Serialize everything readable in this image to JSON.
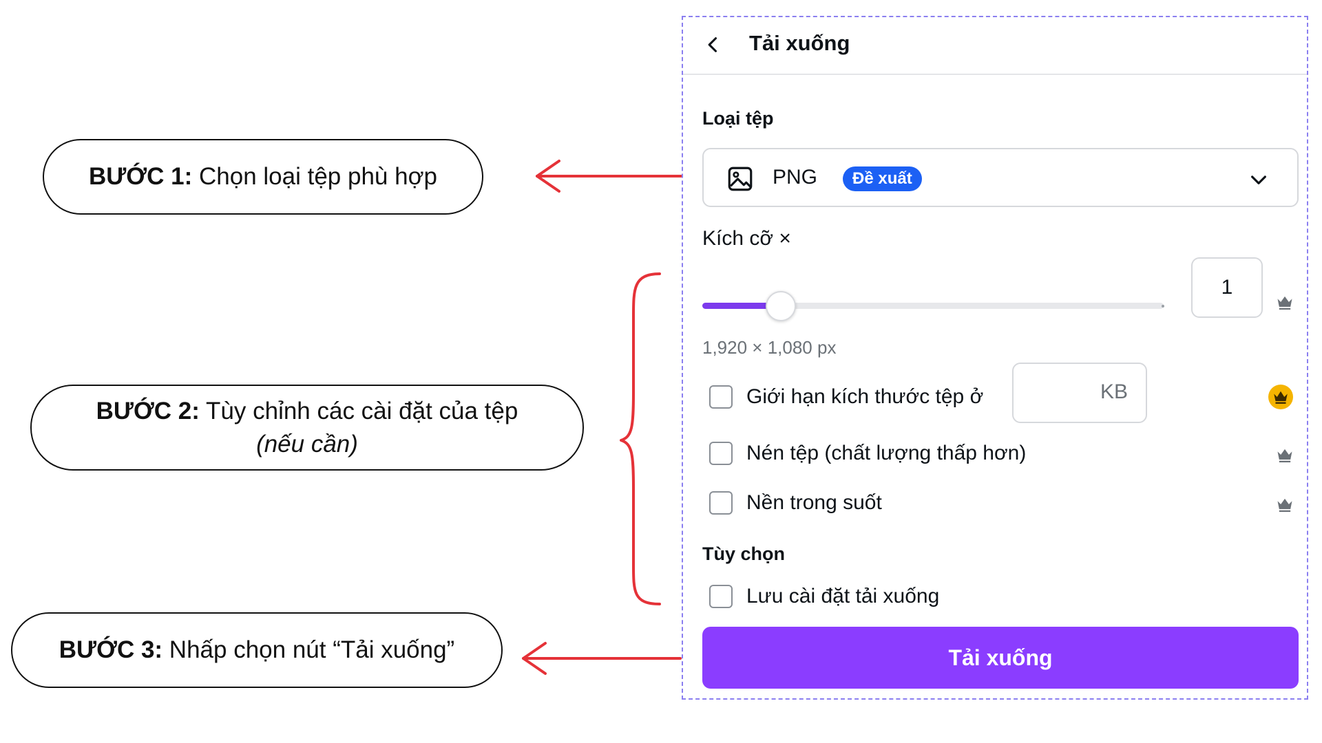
{
  "steps": {
    "step1": {
      "bold": "BƯỚC 1:",
      "text": " Chọn loại tệp phù hợp"
    },
    "step2": {
      "bold": "BƯỚC 2:",
      "text": " Tùy chỉnh các cài đặt của tệp",
      "note": "(nếu cần)"
    },
    "step3": {
      "bold": "BƯỚC 3:",
      "text": " Nhấp chọn nút “Tải xuống”"
    }
  },
  "panel": {
    "title": "Tải xuống",
    "back_icon": "chevron-left-icon",
    "file_type": {
      "label": "Loại tệp",
      "value": "PNG",
      "badge": "Đề xuất",
      "icon": "image-icon"
    },
    "size": {
      "label": "Kích cỡ ×",
      "scale_value": "1",
      "slider_fraction": 0.17,
      "dimensions": "1,920 × 1,080 px"
    },
    "options": {
      "limit_file_size": {
        "label": "Giới hạn kích thước tệp ở",
        "unit": "KB",
        "checked": false
      },
      "compress": {
        "label": "Nén tệp (chất lượng thấp hơn)",
        "checked": false
      },
      "transparent": {
        "label": "Nền trong suốt",
        "checked": false
      }
    },
    "preferences": {
      "label": "Tùy chọn",
      "save_settings": {
        "label": "Lưu cài đặt tải xuống",
        "checked": false
      }
    },
    "download_button": "Tải xuống"
  },
  "colors": {
    "accent": "#8b3dff",
    "slider": "#7c3aed",
    "badge": "#1c60f4",
    "arrow": "#e53238",
    "crown_gold": "#f5b400"
  }
}
